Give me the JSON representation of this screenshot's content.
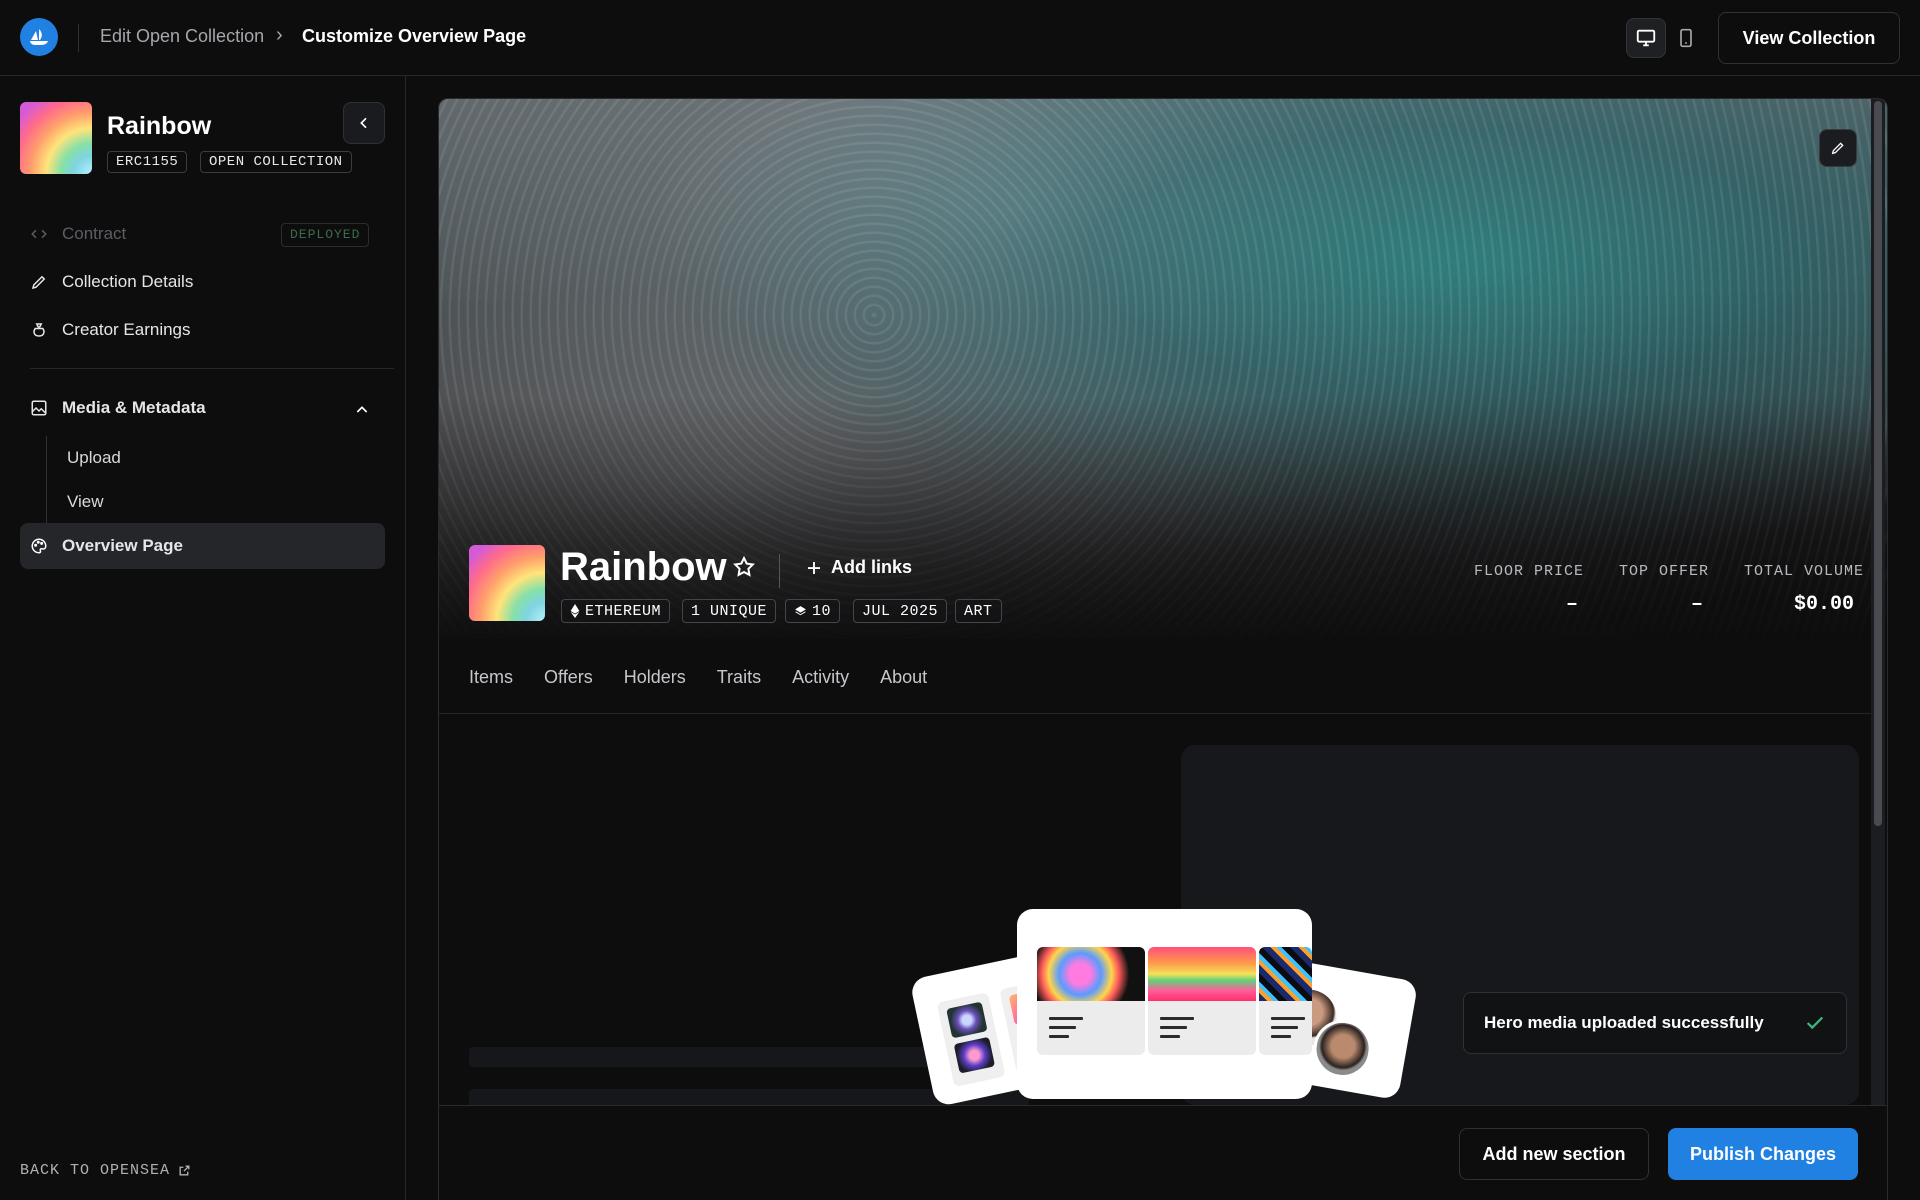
{
  "breadcrumb": {
    "parent": "Edit Open Collection",
    "separator": "›",
    "current": "Customize Overview Page"
  },
  "header": {
    "view_collection_label": "View Collection",
    "preview_modes": [
      "desktop-icon",
      "mobile-icon"
    ]
  },
  "sidebar": {
    "collection_name": "Rainbow",
    "tags": [
      "ERC1155",
      "OPEN COLLECTION"
    ],
    "nav": [
      {
        "label": "Contract",
        "icon": "code-icon",
        "badge": "DEPLOYED",
        "disabled": true
      },
      {
        "label": "Collection Details",
        "icon": "pencil-icon"
      },
      {
        "label": "Creator Earnings",
        "icon": "money-bag-icon"
      }
    ],
    "section": {
      "label": "Media & Metadata",
      "icon": "image-icon",
      "expanded": true,
      "children": [
        "Upload",
        "View"
      ]
    },
    "active_item": {
      "label": "Overview Page",
      "icon": "palette-icon"
    },
    "back_link": "BACK TO OPENSEA"
  },
  "preview": {
    "collection_name": "Rainbow",
    "add_links_label": "Add links",
    "tags": [
      "ETHEREUM",
      "1 UNIQUE",
      "10",
      "JUL 2025",
      "ART"
    ],
    "stats": [
      {
        "label": "FLOOR PRICE",
        "value": "–"
      },
      {
        "label": "TOP OFFER",
        "value": "–"
      },
      {
        "label": "TOTAL VOLUME",
        "value": "$0.00"
      }
    ],
    "tabs": [
      "Items",
      "Offers",
      "Holders",
      "Traits",
      "Activity",
      "About"
    ]
  },
  "toast": {
    "message": "Hero media uploaded successfully"
  },
  "footer": {
    "add_section_label": "Add new section",
    "publish_label": "Publish Changes"
  },
  "colors": {
    "accent": "#2081e2",
    "background": "#0d0d0e",
    "active_nav": "#25262a",
    "deployed_text": "#3d6a4a",
    "success": "#3fb27f"
  }
}
